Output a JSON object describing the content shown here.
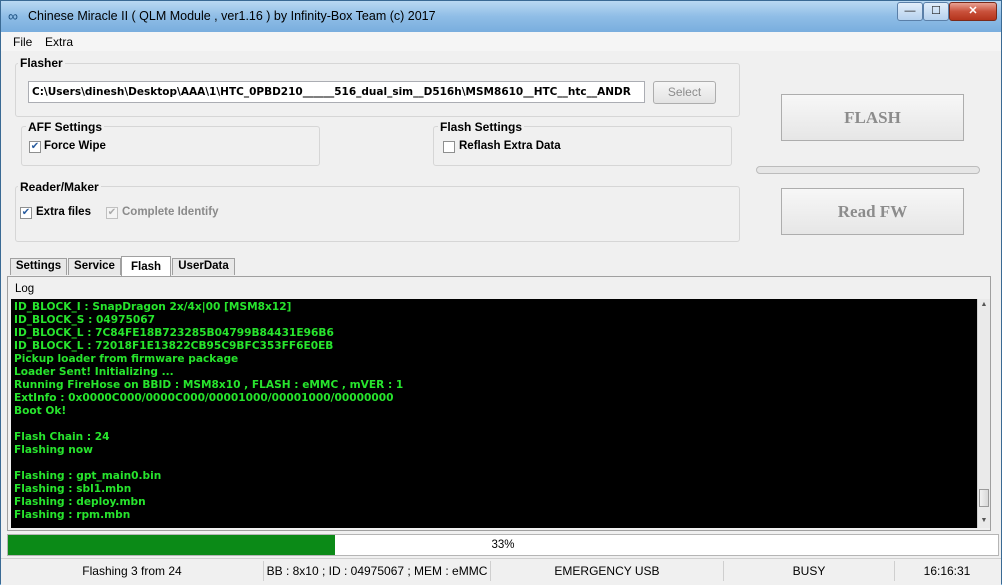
{
  "window": {
    "title": "Chinese Miracle II ( QLM Module , ver1.16  ) by Infinity-Box Team (c) 2017"
  },
  "titlebar_buttons": {
    "minimize": "—",
    "maximize": "☐",
    "close": "✕"
  },
  "menu": [
    "File",
    "Extra"
  ],
  "flasher": {
    "label": "Flasher",
    "path": "C:\\Users\\dinesh\\Desktop\\AAA\\1\\HTC_0PBD210______516_dual_sim__D516h\\MSM8610__HTC__htc__ANDR",
    "select_label": "Select"
  },
  "aff_settings": {
    "label": "AFF Settings",
    "force_wipe_label": "Force Wipe",
    "force_wipe_checked": true
  },
  "flash_settings": {
    "label": "Flash Settings",
    "reflash_label": "Reflash Extra Data",
    "reflash_checked": false
  },
  "reader_maker": {
    "label": "Reader/Maker",
    "extra_files_label": "Extra files",
    "extra_files_checked": true,
    "complete_identify_label": "Complete Identify",
    "complete_identify_checked": true
  },
  "buttons": {
    "flash": "FLASH",
    "read_fw": "Read FW"
  },
  "tabs": [
    "Settings",
    "Service",
    "Flash",
    "UserData"
  ],
  "active_tab": "Flash",
  "log": {
    "label": "Log",
    "lines": [
      "ID_BLOCK_I : SnapDragon 2x/4x|00 [MSM8x12]",
      "ID_BLOCK_S : 04975067",
      "ID_BLOCK_L : 7C84FE18B723285B04799B84431E96B6",
      "ID_BLOCK_L : 72018F1E13822CB95C9BFC353FF6E0EB",
      "Pickup loader from firmware package",
      "Loader Sent! Initializing ...",
      "Running FireHose on BBID : MSM8x10 , FLASH : eMMC , mVER : 1",
      "ExtInfo : 0x0000C000/0000C000/00001000/00001000/00000000",
      "Boot Ok!",
      "",
      "Flash Chain : 24",
      "Flashing now",
      "",
      "Flashing : gpt_main0.bin",
      "Flashing : sbl1.mbn",
      "Flashing : deploy.mbn",
      "Flashing : rpm.mbn"
    ]
  },
  "progress": {
    "percent": 33,
    "text": "33%",
    "fill_color": "#0b8a17"
  },
  "status": {
    "message": "Flashing 3 from 24",
    "device_info": "BB : 8x10 ; ID : 04975067 ; MEM : eMMC",
    "mode": "EMERGENCY USB",
    "state": "BUSY",
    "time": "16:16:31"
  },
  "colors": {
    "log_text": "#27e42d",
    "log_background": "#000000"
  }
}
